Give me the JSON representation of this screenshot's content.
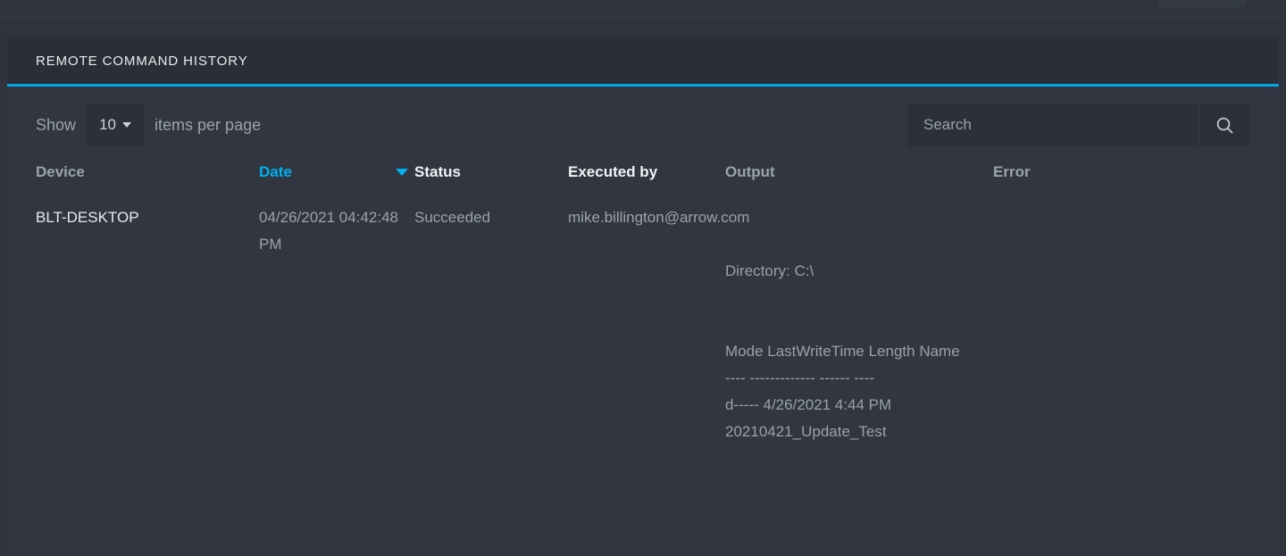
{
  "card": {
    "title": "REMOTE COMMAND HISTORY",
    "accent_color": "#00a6e2"
  },
  "toolbar": {
    "show_label": "Show",
    "page_size_value": "10",
    "items_per_page_label": "items per page",
    "search_placeholder": "Search",
    "search_value": "",
    "search_icon": "search-icon"
  },
  "table": {
    "columns": [
      {
        "label": "Device",
        "emphasis": "muted",
        "sorted": false
      },
      {
        "label": "Date",
        "emphasis": "sorted",
        "sorted": true,
        "sort_direction": "desc"
      },
      {
        "label": "Status",
        "emphasis": "strong",
        "sorted": false
      },
      {
        "label": "Executed by",
        "emphasis": "strong",
        "sorted": false
      },
      {
        "label": "Output",
        "emphasis": "muted",
        "sorted": false
      },
      {
        "label": "Error",
        "emphasis": "muted",
        "sorted": false
      }
    ],
    "rows": [
      {
        "device": "BLT-DESKTOP",
        "date": "04/26/2021 04:42:48 PM",
        "status": "Succeeded",
        "executed_by": "mike.billington@arrow.com",
        "output": "\n\nDirectory: C:\\\n\n\nMode LastWriteTime Length Name\n---- ------------- ------ ----\nd----- 4/26/2021 4:44 PM 20210421_Update_Test",
        "error": ""
      }
    ]
  }
}
